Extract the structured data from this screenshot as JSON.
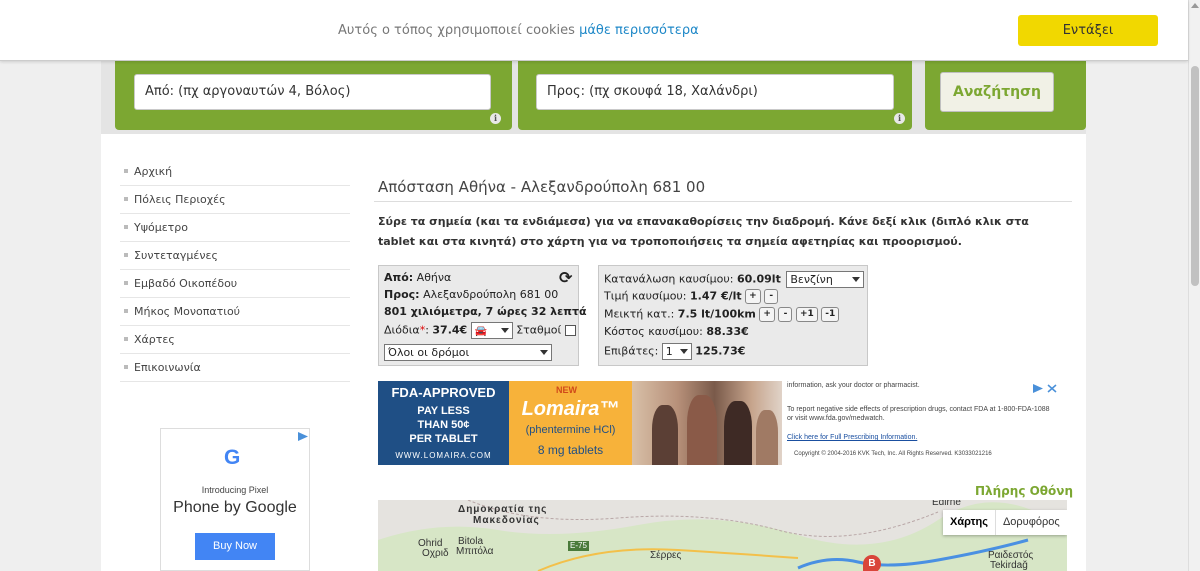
{
  "cookie": {
    "text": "Αυτός ο τόπος χρησιμοποιεί cookies",
    "link": "μάθε περισσότερα",
    "ok_label": "Εντάξει"
  },
  "search": {
    "from_placeholder": "Από: (πχ αργοναυτών 4, Βόλος)",
    "to_placeholder": "Προς: (πχ σκουφά 18, Χαλάνδρι)",
    "button_label": "Αναζήτηση",
    "info_icon": "i"
  },
  "sidebar": {
    "items": [
      {
        "label": "Αρχική"
      },
      {
        "label": "Πόλεις Περιοχές"
      },
      {
        "label": "Υψόμετρο"
      },
      {
        "label": "Συντεταγμένες"
      },
      {
        "label": "Εμβαδό Οικοπέδου"
      },
      {
        "label": "Μήκος Μονοπατιού"
      },
      {
        "label": "Χάρτες"
      },
      {
        "label": "Επικοινωνία"
      }
    ]
  },
  "side_ad": {
    "logo": "G",
    "intro": "Introducing Pixel",
    "headline": "Phone by Google",
    "button": "Buy Now"
  },
  "main": {
    "title": "Απόσταση Αθήνα - Αλεξανδρούπολη 681 00",
    "instructions": "Σύρε τα σημεία (και τα ενδιάμεσα) για να επανακαθορίσεις την διαδρομή. Κάνε δεξί κλικ (διπλό κλικ στα tablet και στα κινητά) στο χάρτη για να τροποποιήσεις τα σημεία αφετηρίας και προορισμού."
  },
  "route_panel": {
    "from_label": "Από:",
    "from_value": "Αθήνα",
    "to_label": "Προς:",
    "to_value": "Αλεξανδρούπολη 681 00",
    "summary": "801 χιλιόμετρα, 7 ώρες 32 λεπτά",
    "tolls_label": "Διόδια",
    "tolls_star": "*",
    "tolls_value": "37.4€",
    "stations_label": "Σταθμοί",
    "roads_option": "Όλοι οι δρόμοι",
    "refresh_icon": "⟳",
    "car_icon": "🚘"
  },
  "fuel_panel": {
    "consumption_label": "Κατανάλωση καυσίμου:",
    "consumption_value": "60.09lt",
    "fuel_type": "Βενζίνη",
    "price_label": "Τιμή καυσίμου:",
    "price_value": "1.47 €/lt",
    "mixed_label": "Μεικτή κατ.:",
    "mixed_value": "7.5 lt/100km",
    "cost_label": "Κόστος καυσίμου:",
    "cost_value": "88.33€",
    "passengers_label": "Επιβάτες:",
    "passengers_value": "1",
    "per_person_value": "125.73€",
    "btn_plus": "+",
    "btn_minus": "-",
    "btn_plus1": "+1",
    "btn_minus1": "-1"
  },
  "banner": {
    "fda": "FDA-APPROVED",
    "pay_1": "PAY LESS",
    "pay_2": "THAN 50¢",
    "pay_3": "PER TABLET",
    "url": "WWW.LOMAIRA.COM",
    "new": "NEW",
    "brand": "Lomaira™",
    "generic": "(phentermine HCl)",
    "dose": "8 mg tablets",
    "legal_1": "information, ask your doctor or pharmacist.",
    "legal_2": "To report negative side effects of prescription drugs, contact FDA at 1-800-FDA-1088 or visit www.fda.gov/medwatch.",
    "legal_3": "Click here for Full Prescribing Information.",
    "legal_4": "Copyright © 2004-2016 KVK Tech, Inc. All Rights Reserved. K3033021216"
  },
  "map": {
    "fullscreen": "Πλήρης Οθόνη",
    "tab_map": "Χάρτης",
    "tab_satellite": "Δορυφόρος",
    "labels": {
      "macedonia_1": "Δημοκρατία της",
      "macedonia_2": "Μακεδονίας",
      "ochrid": "Ohrid",
      "ochrid_gr": "Οχριδ",
      "bitola": "Bitola",
      "bitola_gr": "Μπιτόλα",
      "serres": "Σέρρες",
      "edirne": "Edirne",
      "rodosto": "Ραιδεστός",
      "tekirdag": "Tekirdağ",
      "e75": "E-75",
      "marker": "B"
    }
  }
}
